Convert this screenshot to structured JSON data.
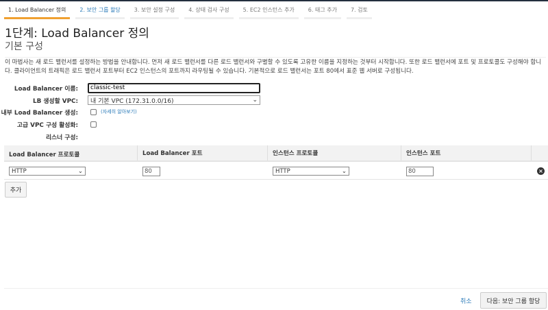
{
  "steps": [
    "1. Load Balancer 정의",
    "2. 보안 그룹 할당",
    "3. 보안 설정 구성",
    "4. 상태 검사 구성",
    "5. EC2 인스턴스 추가",
    "6. 태그 추가",
    "7. 검토"
  ],
  "title": "1단계: Load Balancer 정의",
  "subtitle": "기본 구성",
  "description": "이 마법사는 새 로드 밸런서를 설정하는 방법을 안내합니다. 먼저 새 로드 밸런서를 다른 로드 밸런서와 구별할 수 있도록 고유한 이름을 지정하는 것부터 시작합니다. 또한 로드 밸런서에 포트 및 프로토콜도 구성해야 합니다. 클라이언트의 트래픽은 로드 밸런서 포트부터 EC2 인스턴스의 포트까지 라우팅될 수 있습니다. 기본적으로 로드 밸런서는 포트 80에서 표준 웹 서버로 구성됩니다.",
  "form": {
    "name_label": "Load Balancer 이름:",
    "name_value": "classic-test",
    "vpc_label": "LB 생성할 VPC:",
    "vpc_value": "내 기본 VPC (172.31.0.0/16)",
    "internal_label": "내부 Load Balancer 생성:",
    "learn_more": "(자세히 알아보기)",
    "advanced_label": "고급 VPC 구성 활성화:",
    "listener_label": "리스너 구성:"
  },
  "table": {
    "headers": [
      "Load Balancer 프로토콜",
      "Load Balancer 포트",
      "인스턴스 프로토콜",
      "인스턴스 포트"
    ],
    "rows": [
      {
        "lb_protocol": "HTTP",
        "lb_port": "80",
        "instance_protocol": "HTTP",
        "instance_port": "80"
      }
    ]
  },
  "add_label": "추가",
  "cancel_label": "취소",
  "next_label": "다음: 보안 그룹 할당"
}
